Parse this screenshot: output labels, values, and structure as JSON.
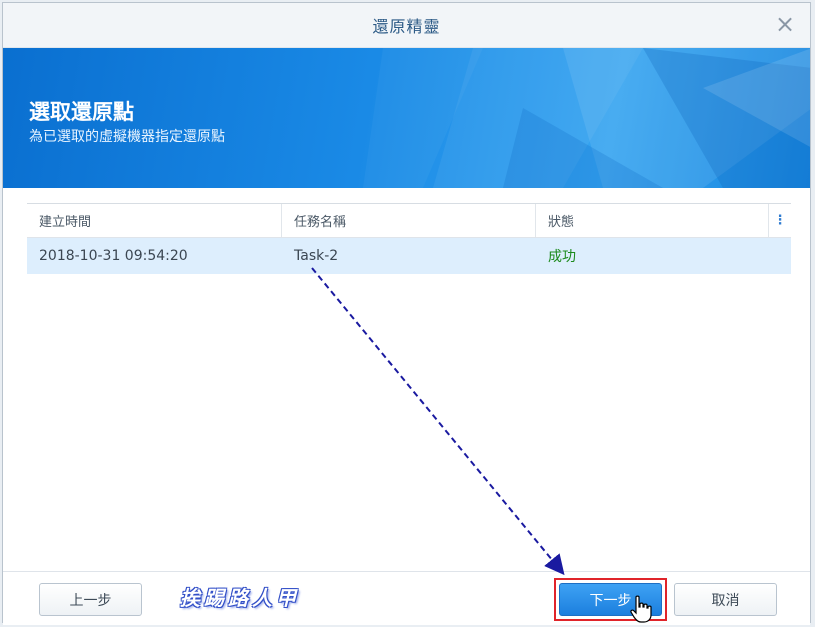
{
  "window": {
    "title": "還原精靈",
    "close_icon": "close-icon"
  },
  "banner": {
    "heading": "選取還原點",
    "subheading": "為已選取的虛擬機器指定還原點"
  },
  "grid": {
    "columns": [
      "建立時間",
      "任務名稱",
      "狀態"
    ],
    "menu_icon": "column-menu-icon",
    "rows": [
      {
        "created": "2018-10-31 09:54:20",
        "task": "Task-2",
        "status": "成功"
      }
    ]
  },
  "footer": {
    "prev_label": "上一步",
    "next_label": "下一步",
    "cancel_label": "取消",
    "watermark": "挨踢路人甲"
  },
  "colors": {
    "accent": "#1c7fde",
    "banner": "#1a8ae6",
    "selected_row": "#ddeefd",
    "success": "#1c8a1c",
    "highlight": "#e0242a",
    "annotation_arrow": "#1a1aa0"
  }
}
